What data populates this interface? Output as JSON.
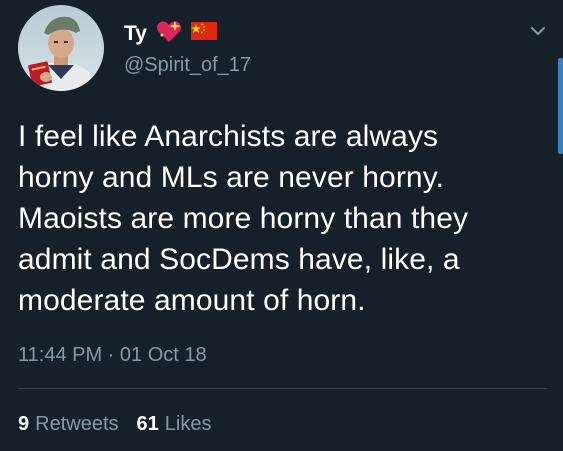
{
  "tweet": {
    "display_name": "Ty",
    "emoji": [
      "sparkling-heart-icon",
      "china-flag-icon"
    ],
    "handle": "@Spirit_of_17",
    "text_lines": [
      "I feel like Anarchists are always",
      "horny and MLs are never horny.",
      "Maoists are more horny than they",
      "admit and SocDems have, like, a",
      "moderate amount of horn."
    ],
    "timestamp": "11:44 PM · 01 Oct 18",
    "retweets": {
      "count": "9",
      "label": "Retweets"
    },
    "likes": {
      "count": "61",
      "label": "Likes"
    }
  },
  "colors": {
    "background": "#15202b",
    "primary_text": "#ffffff",
    "secondary_text": "#8899a6",
    "divider": "#38444d",
    "heart": "#e0245e",
    "flag_red": "#de2910",
    "flag_star": "#ffde00"
  },
  "icons": {
    "menu": "chevron-down-icon"
  }
}
